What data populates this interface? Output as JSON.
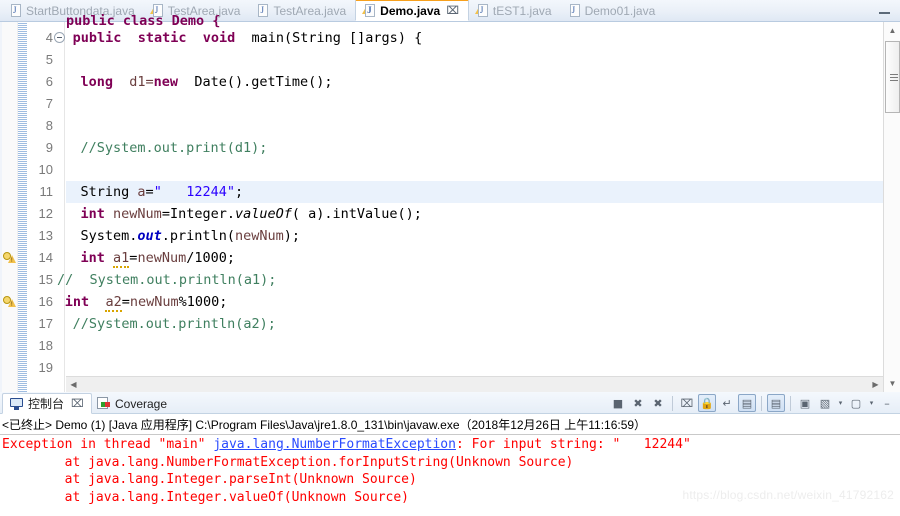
{
  "window": {
    "minimize_label": "minimize"
  },
  "editor_tabs": [
    {
      "label": "StartButtondata.java",
      "icon": "java-file-icon",
      "active": false,
      "warning": false
    },
    {
      "label": "TestArea.java",
      "icon": "java-file-warning-icon",
      "active": false,
      "warning": true
    },
    {
      "label": "TestArea.java",
      "icon": "java-file-icon",
      "active": false,
      "warning": false
    },
    {
      "label": "Demo.java",
      "icon": "java-file-warning-icon",
      "active": true,
      "warning": true,
      "close": "⌧"
    },
    {
      "label": "tEST1.java",
      "icon": "java-file-warning-icon",
      "active": false,
      "warning": true
    },
    {
      "label": "Demo01.java",
      "icon": "java-file-icon",
      "active": false,
      "warning": false
    }
  ],
  "editor": {
    "clipped_top_line": "public class Demo {",
    "lines": [
      {
        "num": "4",
        "fold": true,
        "bulb": false,
        "highlight": false,
        "indent": 9,
        "tokens": [
          {
            "t": "public",
            "c": "kw"
          },
          {
            "t": "  ",
            "c": ""
          },
          {
            "t": "static",
            "c": "kw"
          },
          {
            "t": "  ",
            "c": ""
          },
          {
            "t": "void",
            "c": "kw"
          },
          {
            "t": "  ",
            "c": ""
          },
          {
            "t": "main(String []args) {",
            "c": ""
          }
        ]
      },
      {
        "num": "5",
        "fold": false,
        "bulb": false,
        "highlight": false,
        "indent": 0,
        "tokens": []
      },
      {
        "num": "6",
        "fold": false,
        "bulb": false,
        "highlight": false,
        "indent": 10,
        "tokens": [
          {
            "t": "long",
            "c": "kw"
          },
          {
            "t": "  ",
            "c": ""
          },
          {
            "t": "d1=",
            "c": "lv"
          },
          {
            "t": "new",
            "c": "kw"
          },
          {
            "t": "  Date().getTime();",
            "c": ""
          }
        ]
      },
      {
        "num": "7",
        "fold": false,
        "bulb": false,
        "highlight": false,
        "indent": 0,
        "tokens": []
      },
      {
        "num": "8",
        "fold": false,
        "bulb": false,
        "highlight": false,
        "indent": 0,
        "tokens": []
      },
      {
        "num": "9",
        "fold": false,
        "bulb": false,
        "highlight": false,
        "indent": 10,
        "tokens": [
          {
            "t": "//System.out.print(d1);",
            "c": "cmt"
          }
        ]
      },
      {
        "num": "10",
        "fold": false,
        "bulb": false,
        "highlight": false,
        "indent": 0,
        "tokens": []
      },
      {
        "num": "11",
        "fold": false,
        "bulb": false,
        "highlight": true,
        "indent": 10,
        "tokens": [
          {
            "t": "String ",
            "c": ""
          },
          {
            "t": "a",
            "c": "lv"
          },
          {
            "t": "=",
            "c": ""
          },
          {
            "t": "\"   12244\"",
            "c": "str"
          },
          {
            "t": ";",
            "c": ""
          }
        ]
      },
      {
        "num": "12",
        "fold": false,
        "bulb": false,
        "highlight": false,
        "indent": 10,
        "tokens": [
          {
            "t": "int",
            "c": "kw"
          },
          {
            "t": " ",
            "c": ""
          },
          {
            "t": "newNum",
            "c": "lv"
          },
          {
            "t": "=Integer.",
            "c": ""
          },
          {
            "t": "valueOf",
            "c": "mth"
          },
          {
            "t": "( a).intValue();",
            "c": ""
          }
        ]
      },
      {
        "num": "13",
        "fold": false,
        "bulb": false,
        "highlight": false,
        "indent": 10,
        "tokens": [
          {
            "t": "System.",
            "c": ""
          },
          {
            "t": "out",
            "c": "fld"
          },
          {
            "t": ".println(",
            "c": ""
          },
          {
            "t": "newNum",
            "c": "lv"
          },
          {
            "t": ");",
            "c": ""
          }
        ]
      },
      {
        "num": "14",
        "fold": false,
        "bulb": true,
        "highlight": false,
        "indent": 10,
        "tokens": [
          {
            "t": "int",
            "c": "kw"
          },
          {
            "t": " ",
            "c": ""
          },
          {
            "t": "a1",
            "c": "lv wavy"
          },
          {
            "t": "=",
            "c": ""
          },
          {
            "t": "newNum",
            "c": "lv"
          },
          {
            "t": "/1000;",
            "c": ""
          }
        ]
      },
      {
        "num": "15",
        "fold": false,
        "bulb": false,
        "highlight": false,
        "indent": 7,
        "tokens": [
          {
            "t": "//  System.out.println(a1);",
            "c": "cmt"
          }
        ]
      },
      {
        "num": "16",
        "fold": false,
        "bulb": true,
        "highlight": false,
        "indent": 8,
        "tokens": [
          {
            "t": "int",
            "c": "kw"
          },
          {
            "t": "  ",
            "c": ""
          },
          {
            "t": "a2",
            "c": "lv wavy"
          },
          {
            "t": "=",
            "c": ""
          },
          {
            "t": "newNum",
            "c": "lv"
          },
          {
            "t": "%1000;",
            "c": ""
          }
        ]
      },
      {
        "num": "17",
        "fold": false,
        "bulb": false,
        "highlight": false,
        "indent": 9,
        "tokens": [
          {
            "t": "//System.out.println(a2);",
            "c": "cmt"
          }
        ]
      },
      {
        "num": "18",
        "fold": false,
        "bulb": false,
        "highlight": false,
        "indent": 0,
        "tokens": []
      },
      {
        "num": "19",
        "fold": false,
        "bulb": false,
        "highlight": false,
        "indent": 0,
        "tokens": []
      }
    ]
  },
  "console_tabs": [
    {
      "label": "控制台",
      "icon": "console-monitor-icon",
      "active": true,
      "close": "⌧"
    },
    {
      "label": "Coverage",
      "icon": "coverage-report-icon",
      "active": false,
      "close": ""
    }
  ],
  "console_toolbar": [
    {
      "name": "terminate-button",
      "glyph": "■",
      "pressed": false
    },
    {
      "name": "remove-launch-button",
      "glyph": "✖",
      "pressed": false
    },
    {
      "name": "remove-all-terminated-button",
      "glyph": "✖",
      "pressed": false
    },
    {
      "name": "clear-console-button",
      "glyph": "⌧",
      "pressed": false
    },
    {
      "name": "scroll-lock-button",
      "glyph": "🔒",
      "pressed": true
    },
    {
      "name": "word-wrap-button",
      "glyph": "↵",
      "pressed": false
    },
    {
      "name": "show-console-on-output-button",
      "glyph": "▤",
      "pressed": true
    },
    {
      "name": "show-console-on-error-button",
      "glyph": "▤",
      "pressed": true
    },
    {
      "name": "pin-console-button",
      "glyph": "▣",
      "pressed": false
    },
    {
      "name": "display-selected-console-button",
      "glyph": "▧",
      "pressed": false
    },
    {
      "name": "display-selected-console-dropdown",
      "glyph": "▾",
      "pressed": false
    },
    {
      "name": "open-console-button",
      "glyph": "▢",
      "pressed": false
    },
    {
      "name": "open-console-dropdown",
      "glyph": "▾",
      "pressed": false
    },
    {
      "name": "minimize-console-button",
      "glyph": "–",
      "pressed": false
    }
  ],
  "console": {
    "status_line": "<已终止> Demo (1) [Java 应用程序] C:\\Program Files\\Java\\jre1.8.0_131\\bin\\javaw.exe（2018年12月26日 上午11:16:59）",
    "output_lines": [
      {
        "segments": [
          {
            "text": "Exception in thread \"main\" ",
            "link": false
          },
          {
            "text": "java.lang.NumberFormatException",
            "link": true
          },
          {
            "text": ": For input string: \"   12244\"",
            "link": false
          }
        ]
      },
      {
        "segments": [
          {
            "text": "\tat java.lang.NumberFormatException.forInputString(Unknown Source)",
            "link": false
          }
        ]
      },
      {
        "segments": [
          {
            "text": "\tat java.lang.Integer.parseInt(Unknown Source)",
            "link": false
          }
        ]
      },
      {
        "segments": [
          {
            "text": "\tat java.lang.Integer.valueOf(Unknown Source)",
            "link": false
          }
        ]
      }
    ],
    "watermark": "https://blog.csdn.net/weixin_41792162"
  },
  "colors": {
    "keyword": "#7f0055",
    "comment": "#3f7f5f",
    "string": "#2a00ff",
    "field": "#0000c0",
    "error": "#ff0000",
    "link": "#2a4bff",
    "active_tab_top": "#f7a01c",
    "highlight_row": "#eaf2fc"
  }
}
